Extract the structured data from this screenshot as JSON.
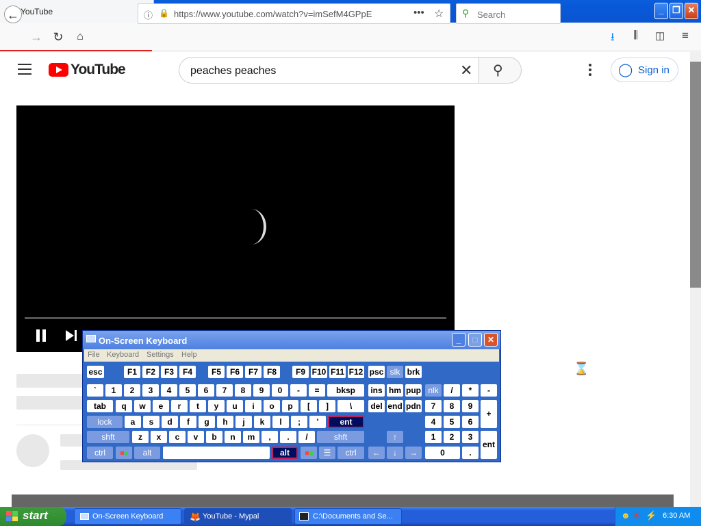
{
  "browser": {
    "tab_title": "YouTube",
    "tab_close": "✕",
    "new_tab": "+",
    "url": "https://www.youtube.com/watch?v=imSefM4GPpE",
    "search_placeholder": "Search"
  },
  "youtube": {
    "logo_text": "YouTube",
    "search_value": "peaches peaches",
    "sign_in_label": "Sign in"
  },
  "osk": {
    "title": "On-Screen Keyboard",
    "menu": [
      "File",
      "Keyboard",
      "Settings",
      "Help"
    ],
    "rows": {
      "fn": [
        "esc",
        "F1",
        "F2",
        "F3",
        "F4",
        "F5",
        "F6",
        "F7",
        "F8",
        "F9",
        "F10",
        "F11",
        "F12",
        "psc",
        "slk",
        "brk"
      ],
      "num": [
        "`",
        "1",
        "2",
        "3",
        "4",
        "5",
        "6",
        "7",
        "8",
        "9",
        "0",
        "-",
        "=",
        "bksp",
        "ins",
        "hm",
        "pup",
        "nlk",
        "/",
        "*",
        "-"
      ],
      "top": [
        "tab",
        "q",
        "w",
        "e",
        "r",
        "t",
        "y",
        "u",
        "i",
        "o",
        "p",
        "[",
        "]",
        "\\",
        "del",
        "end",
        "pdn",
        "7",
        "8",
        "9",
        "+"
      ],
      "home": [
        "lock",
        "a",
        "s",
        "d",
        "f",
        "g",
        "h",
        "j",
        "k",
        "l",
        ";",
        "'",
        "ent",
        "4",
        "5",
        "6"
      ],
      "shift": [
        "shft",
        "z",
        "x",
        "c",
        "v",
        "b",
        "n",
        "m",
        ",",
        ".",
        "/",
        "shft",
        "↑",
        "1",
        "2",
        "3",
        "ent"
      ],
      "bottom": [
        "ctrl",
        "alt",
        "",
        "alt",
        "ctrl",
        "←",
        "↓",
        "→",
        "0",
        "."
      ]
    }
  },
  "taskbar": {
    "start_label": "start",
    "items": [
      "On-Screen Keyboard",
      "YouTube - Mypal",
      "C:\\Documents and Se..."
    ],
    "clock": "6:30 AM"
  }
}
